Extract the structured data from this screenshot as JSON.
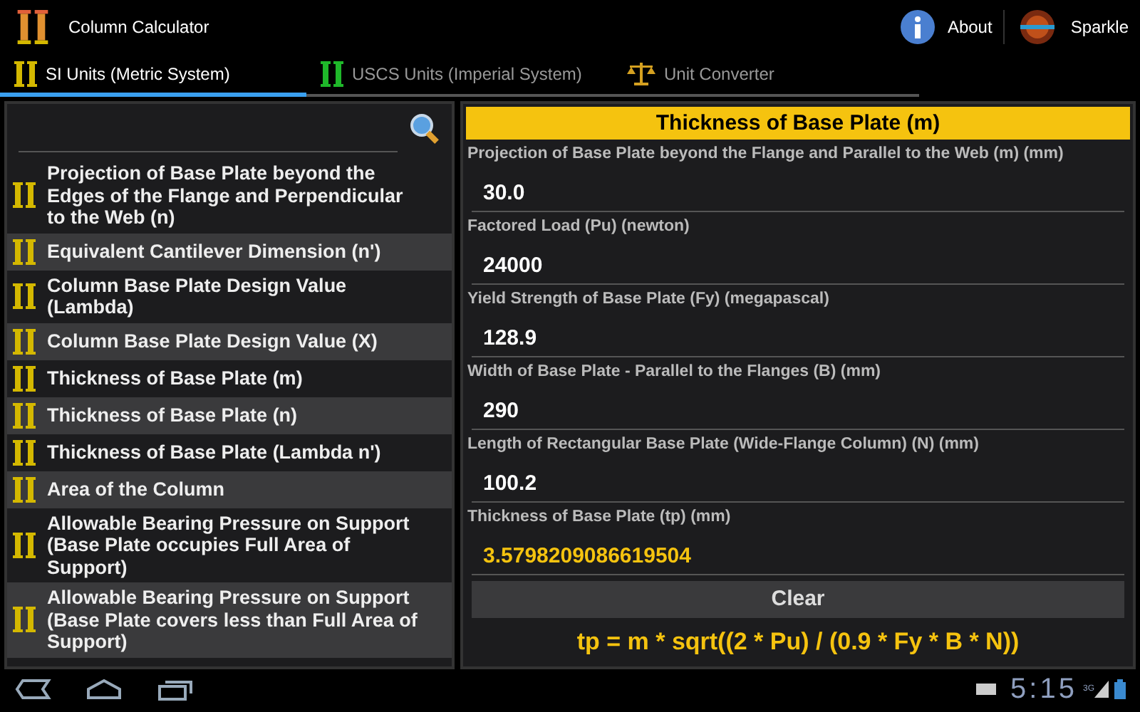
{
  "app_bar": {
    "title": "Column Calculator",
    "actions": [
      {
        "kind": "about",
        "label": "About"
      },
      {
        "kind": "sparkle",
        "label": "Sparkle"
      }
    ]
  },
  "tabs": [
    {
      "kind": "column-yellow",
      "label": "SI Units (Metric System)",
      "selected": true
    },
    {
      "kind": "column-green",
      "label": "USCS Units (Imperial System)",
      "selected": false
    },
    {
      "kind": "scale",
      "label": "Unit Converter",
      "selected": false
    }
  ],
  "formula_list": {
    "items": [
      {
        "label": "Projection of Base Plate beyond the Edges of the Flange and Perpendicular to the Web (n)"
      },
      {
        "label": "Equivalent Cantilever Dimension (n')"
      },
      {
        "label": "Column Base Plate Design Value (Lambda)"
      },
      {
        "label": "Column Base Plate Design Value (X)"
      },
      {
        "label": "Thickness of Base Plate (m)"
      },
      {
        "label": "Thickness of Base Plate (n)"
      },
      {
        "label": "Thickness of Base Plate (Lambda n')"
      },
      {
        "label": "Area of the Column"
      },
      {
        "label": "Allowable Bearing Pressure on Support (Base Plate occupies Full Area of Support)"
      },
      {
        "label": "Allowable Bearing Pressure on Support (Base Plate covers less than Full Area of Support)"
      }
    ]
  },
  "calculator": {
    "title": "Thickness of Base Plate (m)",
    "fields": [
      {
        "kind": "input",
        "label": "Projection of Base Plate beyond the Flange and Parallel to the Web (m) (mm)",
        "value": "30.0"
      },
      {
        "kind": "input",
        "label": "Factored Load (Pu) (newton)",
        "value": "24000"
      },
      {
        "kind": "input",
        "label": "Yield Strength of Base Plate (Fy) (megapascal)",
        "value": "128.9"
      },
      {
        "kind": "input",
        "label": "Width of Base Plate - Parallel to the Flanges (B) (mm)",
        "value": "290"
      },
      {
        "kind": "input",
        "label": "Length of Rectangular Base Plate (Wide-Flange Column) (N) (mm)",
        "value": "100.2"
      },
      {
        "kind": "result",
        "label": "Thickness of Base Plate (tp) (mm)",
        "value": "3.5798209086619504"
      }
    ],
    "clear_button": "Clear",
    "formula": "tp = m * sqrt((2 * Pu) / (0.9 * Fy * B * N))"
  },
  "status_bar": {
    "time": "5:15",
    "network": "3G"
  }
}
